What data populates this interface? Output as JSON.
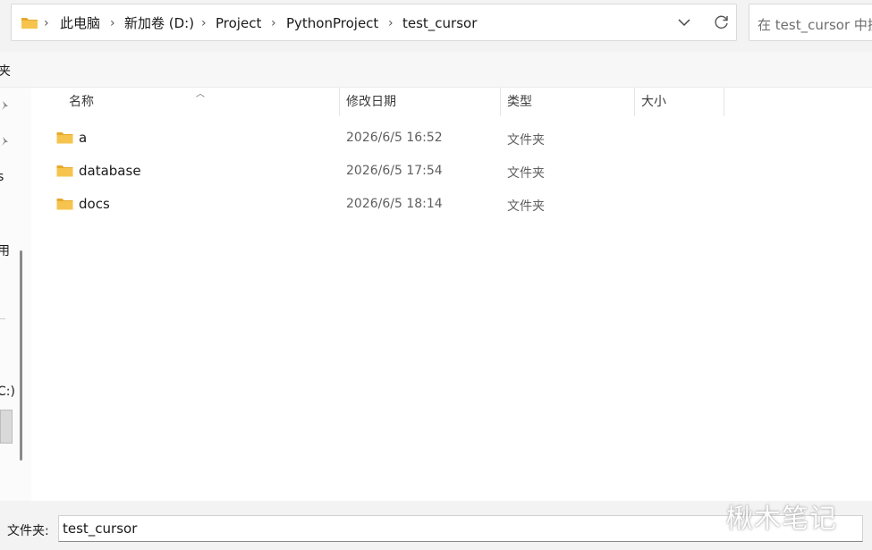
{
  "breadcrumb": {
    "items": [
      "此电脑",
      "新加卷 (D:)",
      "Project",
      "PythonProject",
      "test_cursor"
    ],
    "separator": "›"
  },
  "search": {
    "placeholder": "在 test_cursor 中搜"
  },
  "strip": {
    "label": "夹"
  },
  "nav": {
    "texts": [
      "s",
      "用",
      "C:)"
    ]
  },
  "columns": {
    "name": "名称",
    "modified": "修改日期",
    "type": "类型",
    "size": "大小"
  },
  "files": [
    {
      "name": "a",
      "modified": "2026/6/5 16:52",
      "type": "文件夹"
    },
    {
      "name": "database",
      "modified": "2026/6/5 17:54",
      "type": "文件夹"
    },
    {
      "name": "docs",
      "modified": "2026/6/5 18:14",
      "type": "文件夹"
    }
  ],
  "bottom": {
    "label": "文件夹:",
    "value": "test_cursor"
  },
  "watermark": {
    "text": "楸木笔记"
  },
  "colors": {
    "folder": "#f6c44e",
    "folder_dark": "#e6a92a"
  },
  "icons": {
    "folder": "folder-icon",
    "dropdown": "chevron-down-icon",
    "refresh": "refresh-icon",
    "pin": "pin-icon",
    "sort": "sort-up-icon"
  }
}
